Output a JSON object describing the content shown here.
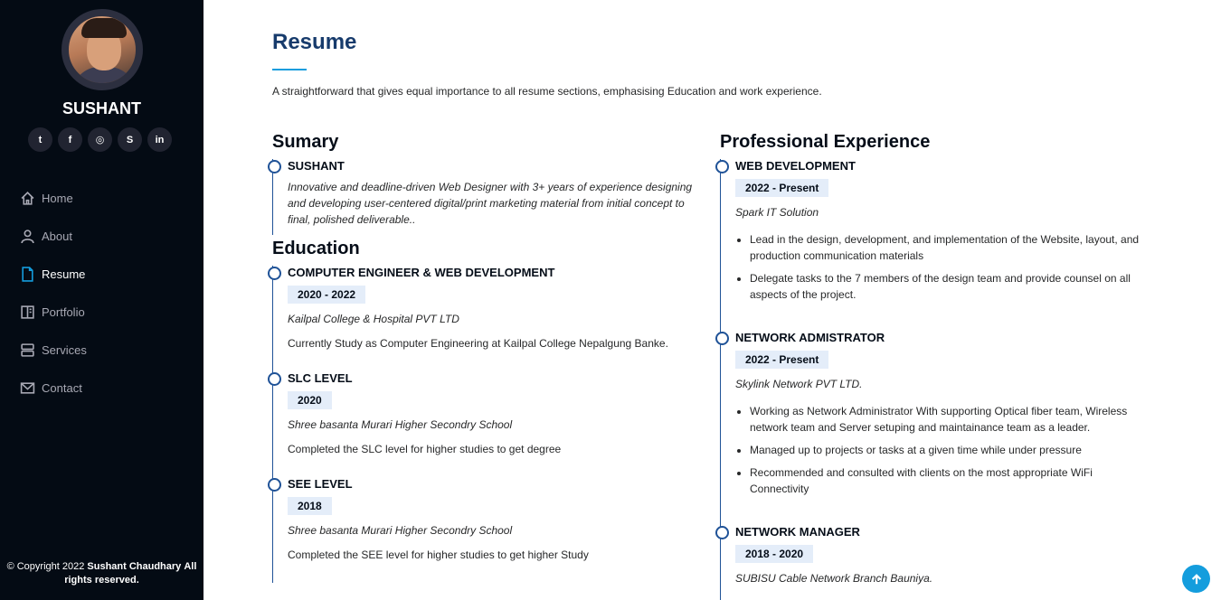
{
  "sidebar": {
    "name": "SUSHANT",
    "social": [
      {
        "icon": "twitter-icon",
        "glyph": "t"
      },
      {
        "icon": "facebook-icon",
        "glyph": "f"
      },
      {
        "icon": "instagram-icon",
        "glyph": "◎"
      },
      {
        "icon": "skype-icon",
        "glyph": "S"
      },
      {
        "icon": "linkedin-icon",
        "glyph": "in"
      }
    ],
    "nav": [
      {
        "label": "Home",
        "icon": "home-icon"
      },
      {
        "label": "About",
        "icon": "user-icon"
      },
      {
        "label": "Resume",
        "icon": "file-icon",
        "active": true
      },
      {
        "label": "Portfolio",
        "icon": "book-icon"
      },
      {
        "label": "Services",
        "icon": "server-icon"
      },
      {
        "label": "Contact",
        "icon": "envelope-icon"
      }
    ],
    "copyright_prefix": "© Copyright 2022",
    "copyright_name": "Sushant Chaudhary",
    "copyright_suffix": "All rights reserved."
  },
  "main": {
    "title": "Resume",
    "intro": "A straightforward that gives equal importance to all resume sections, emphasising Education and work experience.",
    "summary": {
      "heading": "Sumary",
      "name": "SUSHANT",
      "text": "Innovative and deadline-driven Web Designer with 3+ years of experience designing and developing user-centered digital/print marketing material from initial concept to final, polished deliverable.."
    },
    "education": {
      "heading": "Education",
      "items": [
        {
          "title": "COMPUTER ENGINEER & WEB DEVELOPMENT",
          "date": "2020 - 2022",
          "place": "Kailpal College & Hospital PVT LTD",
          "desc": "Currently Study as Computer Engineering at Kailpal College Nepalgung Banke."
        },
        {
          "title": "SLC LEVEL",
          "date": "2020",
          "place": "Shree basanta Murari Higher Secondry School",
          "desc": "Completed the SLC level for higher studies to get degree"
        },
        {
          "title": "SEE LEVEL",
          "date": "2018",
          "place": "Shree basanta Murari Higher Secondry School",
          "desc": "Completed the SEE level for higher studies to get higher Study"
        }
      ]
    },
    "experience": {
      "heading": "Professional Experience",
      "items": [
        {
          "title": "WEB DEVELOPMENT",
          "date": "2022 - Present",
          "place": "Spark IT Solution",
          "bullets": [
            "Lead in the design, development, and implementation of the Website, layout, and production communication materials",
            "Delegate tasks to the 7 members of the design team and provide counsel on all aspects of the project."
          ]
        },
        {
          "title": "NETWORK ADMISTRATOR",
          "date": "2022 - Present",
          "place": "Skylink Network PVT LTD.",
          "bullets": [
            "Working as Network Administrator With supporting Optical fiber team, Wireless network team and Server setuping and maintainance team as a leader.",
            "Managed up to projects or tasks at a given time while under pressure",
            "Recommended and consulted with clients on the most appropriate WiFi Connectivity"
          ]
        },
        {
          "title": "NETWORK MANAGER",
          "date": "2018 - 2020",
          "place": "SUBISU Cable Network Branch Bauniya.",
          "bullets": []
        }
      ]
    }
  },
  "colors": {
    "sidebar_bg": "#040b14",
    "accent": "#149ddd",
    "title": "#173b6c",
    "timeline": "#1f5297",
    "date_bg": "#e4edf9"
  }
}
